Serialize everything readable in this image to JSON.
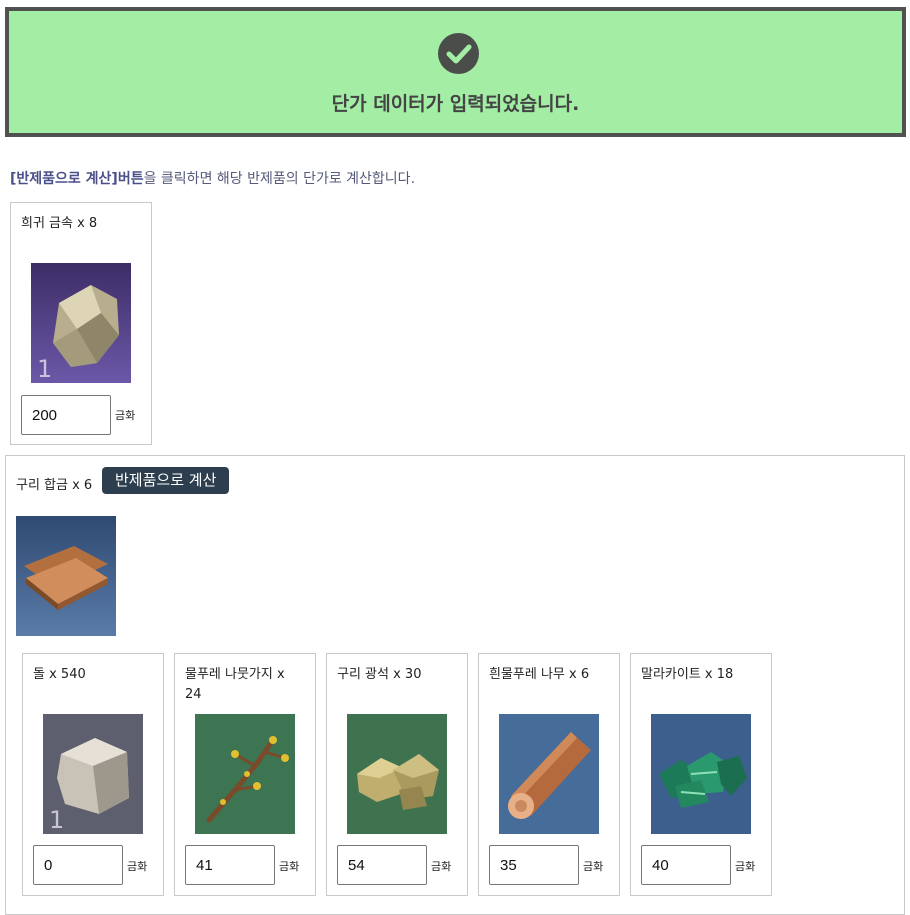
{
  "banner": {
    "icon": "check-circle-icon",
    "message": "단가 데이터가 입력되었습니다.",
    "color": "#a3eda5"
  },
  "instruction": {
    "highlight": "[반제품으로 계산]버튼",
    "text": "을 클릭하면 해당 반제품의 단가로 계산합니다."
  },
  "top_material": {
    "name": "희귀 금속 x 8",
    "icon": "rare-metal-icon",
    "grade": "1",
    "price": "200",
    "unit": "금화"
  },
  "group": {
    "name": "구리 합금 x 6",
    "button_label": "반제품으로 계산",
    "icon": "copper-alloy-icon",
    "materials": [
      {
        "name": "돌 x 540",
        "icon": "stone-icon",
        "grade": "1",
        "price": "0",
        "unit": "금화"
      },
      {
        "name": "물푸레 나뭇가지 x 24",
        "icon": "ash-branch-icon",
        "grade": "",
        "price": "41",
        "unit": "금화"
      },
      {
        "name": "구리 광석 x 30",
        "icon": "copper-ore-icon",
        "grade": "",
        "price": "54",
        "unit": "금화"
      },
      {
        "name": "흰물푸레 나무 x 6",
        "icon": "white-ash-log-icon",
        "grade": "",
        "price": "35",
        "unit": "금화"
      },
      {
        "name": "말라카이트 x 18",
        "icon": "malachite-icon",
        "grade": "",
        "price": "40",
        "unit": "금화"
      }
    ]
  }
}
